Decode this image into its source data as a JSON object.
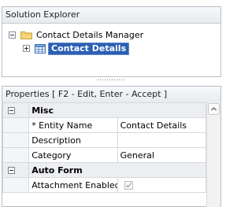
{
  "solution_explorer": {
    "title": "Solution Explorer",
    "tree": {
      "root_label": "Contact Details Manager",
      "child_label": "Contact Details"
    }
  },
  "properties": {
    "title": "Properties [ F2 - Edit, Enter - Accept ]",
    "categories": [
      {
        "name": "Misc",
        "rows": [
          {
            "name": "* Entity Name",
            "value": "Contact Details"
          },
          {
            "name": "Description",
            "value": ""
          },
          {
            "name": "Category",
            "value": "General"
          }
        ]
      },
      {
        "name": "Auto Form",
        "rows": [
          {
            "name": "Attachment Enabled",
            "value": "checked"
          }
        ]
      }
    ]
  },
  "colors": {
    "selection": "#2b5fb3",
    "header_gradient": "#e8ebef",
    "border": "#b8bec8"
  }
}
